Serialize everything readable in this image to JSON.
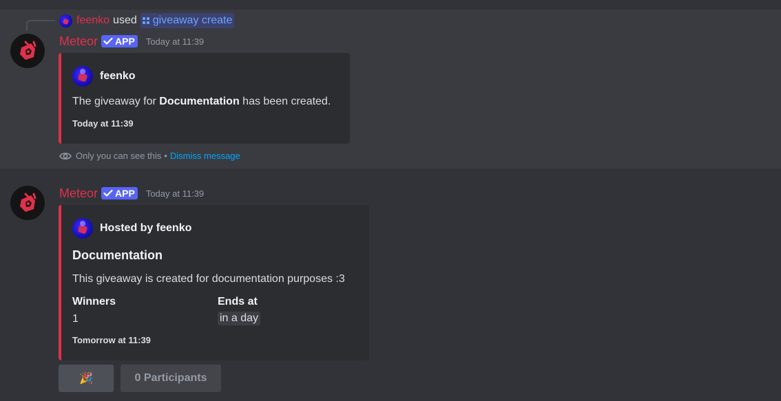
{
  "reply": {
    "user": "feenko",
    "verb": "used",
    "command": "giveaway create"
  },
  "message1": {
    "bot_name": "Meteor",
    "app_tag": "APP",
    "timestamp": "Today at 11:39",
    "embed": {
      "author": "feenko",
      "desc_pre": "The giveaway for ",
      "desc_bold": "Documentation",
      "desc_post": " has been created.",
      "footer": "Today at 11:39"
    },
    "ephemeral_text": "Only you can see this",
    "separator": "•",
    "dismiss": "Dismiss message"
  },
  "message2": {
    "bot_name": "Meteor",
    "app_tag": "APP",
    "timestamp": "Today at 11:39",
    "embed": {
      "author": "Hosted by feenko",
      "title": "Documentation",
      "description": "This giveaway is created for documentation purposes :3",
      "fields": [
        {
          "name": "Winners",
          "value": "1"
        },
        {
          "name": "Ends at",
          "value": "in a day"
        }
      ],
      "footer": "Tomorrow at 11:39"
    },
    "buttons": {
      "emoji": "🎉",
      "participants": "0 Participants"
    }
  },
  "colors": {
    "background": "#313338",
    "highlight": "#393b41",
    "accent": "#e1304a",
    "app_tag": "#5865f2",
    "link": "#00a8fc"
  }
}
